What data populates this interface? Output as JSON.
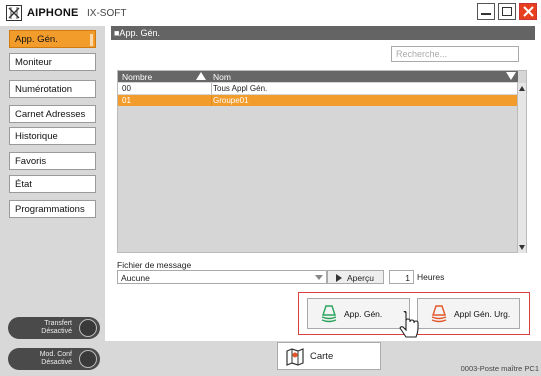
{
  "window": {
    "brand": "AIPHONE",
    "product": "IX-SOFT"
  },
  "sidebar": {
    "items": [
      {
        "label": "App. Gén."
      },
      {
        "label": "Moniteur"
      },
      {
        "label": "Numérotation"
      },
      {
        "label": "Carnet Adresses"
      },
      {
        "label": "Historique"
      },
      {
        "label": "Favoris"
      },
      {
        "label": "État"
      },
      {
        "label": "Programmations"
      }
    ],
    "status": [
      {
        "line1": "Transfert",
        "line2": "Désactivé"
      },
      {
        "line1": "Mod. Conf",
        "line2": "Désactivé"
      }
    ]
  },
  "main": {
    "header": "■App. Gén.",
    "search_placeholder": "Recherche...",
    "table": {
      "columns": [
        "Nombre",
        "Nom"
      ],
      "rows": [
        {
          "number": "00",
          "name": "Tous Appl Gén."
        },
        {
          "number": "01",
          "name": "Groupe01"
        }
      ]
    },
    "message_label": "Fichier de message",
    "message_value": "Aucune",
    "preview_label": "Aperçu",
    "hours_value": "1",
    "hours_label": "Heures",
    "call_general": "App. Gén.",
    "call_urgent": "Appl Gén. Urg.",
    "map_label": "Carte",
    "footer": "0003-Poste maître PC1"
  },
  "colors": {
    "accent": "#f29c2c",
    "header": "#646464",
    "highlight_frame": "#d94040",
    "general_icon": "#2aa35a",
    "urgent_icon": "#e2562a"
  }
}
